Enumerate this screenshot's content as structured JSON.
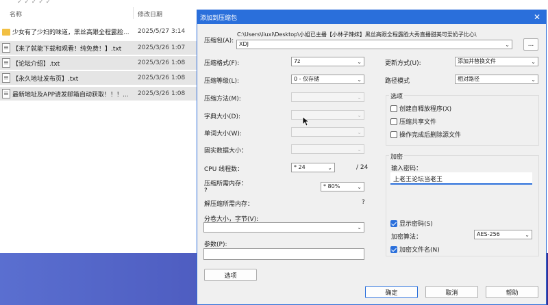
{
  "explorer": {
    "top_glyphs": "✓   ✓   ✓   ✓   ✓",
    "col_name": "名称",
    "col_date": "修改日期",
    "files": [
      {
        "name": "少女有了少妇的味道，黑丝高跟全程露脸...",
        "date": "2025/5/27 3:14",
        "type": "folder"
      },
      {
        "name": "【来了就能下载和观看！纯免费！】.txt",
        "date": "2025/3/26 1:07",
        "type": "txt"
      },
      {
        "name": "【论坛介绍】.txt",
        "date": "2025/3/26 1:08",
        "type": "txt"
      },
      {
        "name": "【永久地址发布页】.txt",
        "date": "2025/3/26 1:08",
        "type": "txt"
      },
      {
        "name": "最新地址及APP请发邮箱自动获取！！！...",
        "date": "2025/3/26 1:08",
        "type": "txt"
      }
    ]
  },
  "dialog": {
    "title": "添加到压缩包",
    "archive_label": "压缩包(A):",
    "archive_path": "C:\\Users\\liuxi\\Desktop\\小姐已主播【小林子辣妹】黑丝高跟全程露脸大秀直播甜美可爱奶子比心\\",
    "archive_name": "XDJ",
    "browse_label": "...",
    "format_label": "压缩格式(F):",
    "format_value": "7z",
    "level_label": "压缩等级(L):",
    "level_value": "0 - 仅存储",
    "method_label": "压缩方法(M):",
    "dict_label": "字典大小(D):",
    "word_label": "单词大小(W):",
    "solid_label": "固实数据大小：",
    "cpu_label": "CPU 线程数：",
    "cpu_value": "* 24",
    "cpu_total": "/ 24",
    "mem_compress_label": "压缩所需内存：",
    "mem_compress_q": "?",
    "mem_compress_value": "* 80%",
    "mem_decompress_label": "解压缩所需内存：",
    "mem_decompress_value": "?",
    "split_label": "分卷大小，字节(V):",
    "params_label": "参数(P):",
    "options_button": "选项",
    "update_label": "更新方式(U):",
    "update_value": "添加并替换文件",
    "path_label": "路径模式",
    "path_value": "相对路径",
    "options_group": "选项",
    "opt_sfx": "创建自释放程序(X)",
    "opt_shared": "压缩共享文件",
    "opt_delete": "操作完成后删除源文件",
    "encrypt_group": "加密",
    "pwd_label": "输入密码：",
    "pwd_value": "上老王论坛当老王",
    "show_pwd": "显示密码(S)",
    "algo_label": "加密算法：",
    "algo_value": "AES-256",
    "encrypt_names": "加密文件名(N)",
    "ok": "确定",
    "cancel": "取消",
    "help": "帮助"
  }
}
